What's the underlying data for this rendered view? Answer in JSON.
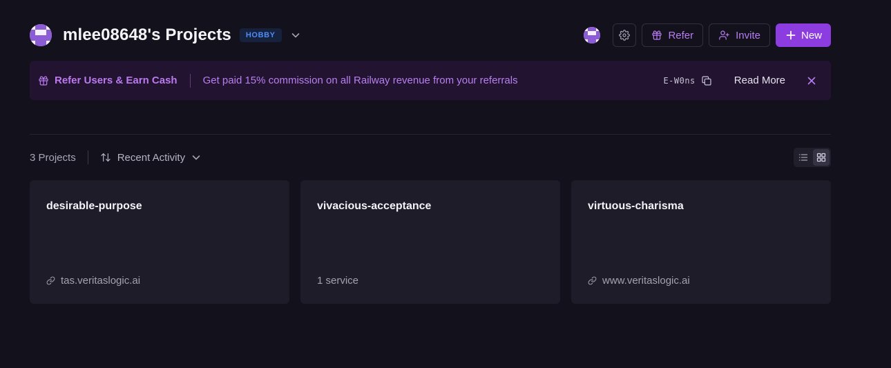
{
  "header": {
    "title": "mlee08648's Projects",
    "plan_badge": "HOBBY",
    "buttons": {
      "refer": "Refer",
      "invite": "Invite",
      "new": "New"
    }
  },
  "banner": {
    "title": "Refer Users & Earn Cash",
    "text": "Get paid 15% commission on all Railway revenue from your referrals",
    "code": "E-W0ns",
    "read_more": "Read More"
  },
  "toolbar": {
    "count": "3 Projects",
    "sort_label": "Recent Activity"
  },
  "projects": [
    {
      "name": "desirable-purpose",
      "footer": "tas.veritaslogic.ai",
      "footer_icon": "link-icon"
    },
    {
      "name": "vivacious-acceptance",
      "footer": "1 service",
      "footer_icon": ""
    },
    {
      "name": "virtuous-charisma",
      "footer": "www.veritaslogic.ai",
      "footer_icon": "link-icon"
    }
  ],
  "colors": {
    "background": "#13111c",
    "accent": "#8d3ce0",
    "banner_bg": "#221430",
    "card_bg": "#1e1c29",
    "badge_text": "#4d8cf5"
  }
}
